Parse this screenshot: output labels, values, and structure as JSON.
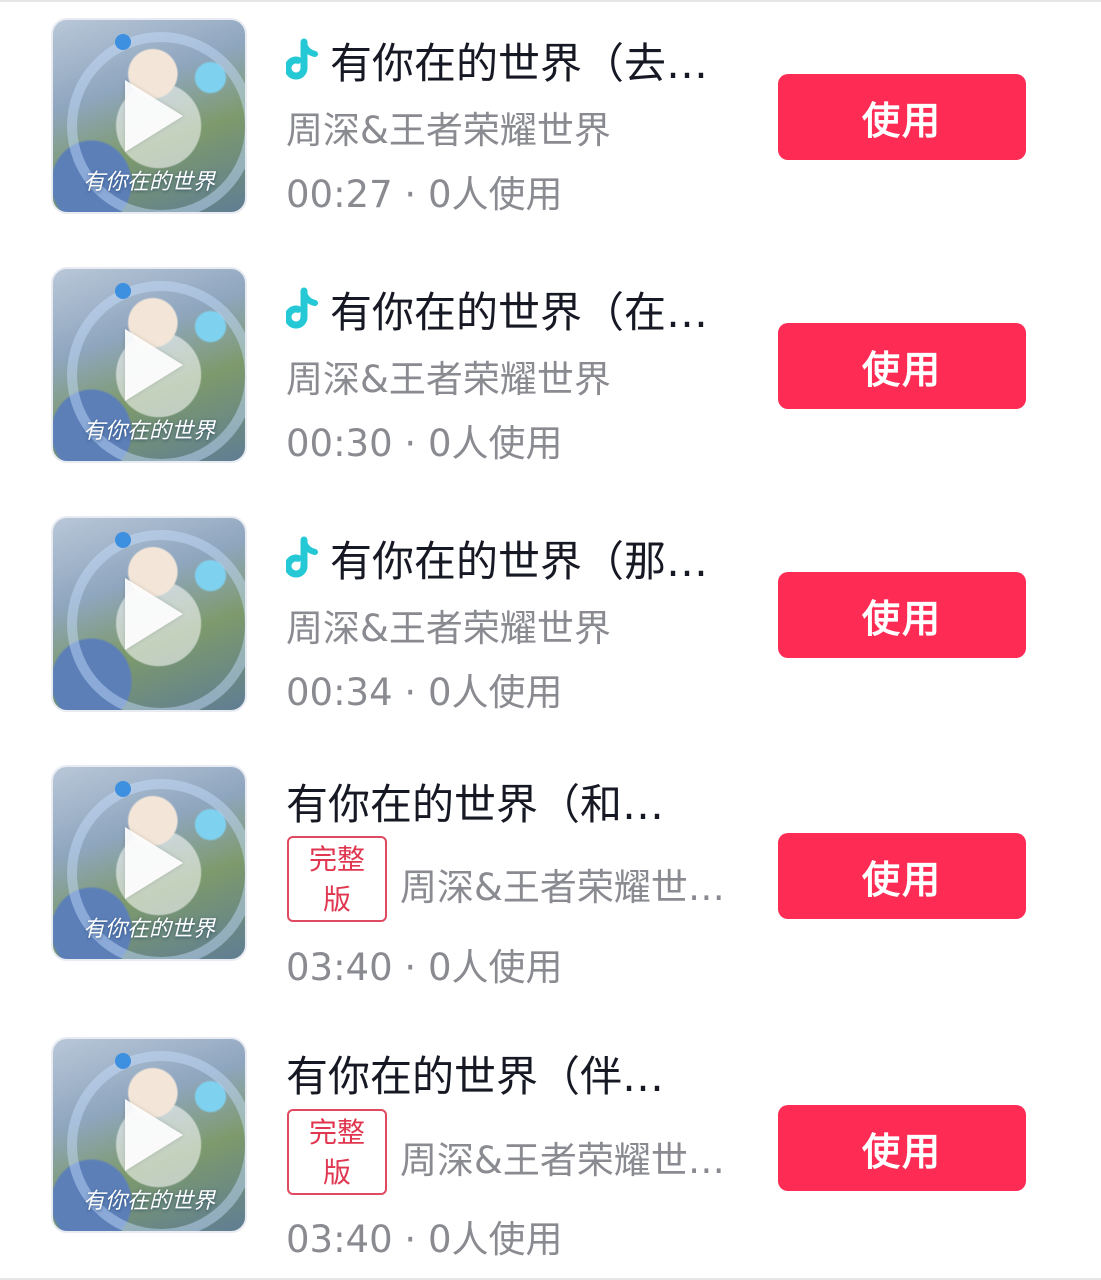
{
  "songs": [
    {
      "title": "有你在的世界（去…",
      "artist": "周深&王者荣耀世界",
      "duration": "00:27",
      "usage": "0人使用",
      "has_douyin_icon": true,
      "full_version": false,
      "cover_title": "有你在的世界",
      "button": "使用"
    },
    {
      "title": "有你在的世界（在…",
      "artist": "周深&王者荣耀世界",
      "duration": "00:30",
      "usage": "0人使用",
      "has_douyin_icon": true,
      "full_version": false,
      "cover_title": "有你在的世界",
      "button": "使用"
    },
    {
      "title": "有你在的世界（那…",
      "artist": "周深&王者荣耀世界",
      "duration": "00:34",
      "usage": "0人使用",
      "has_douyin_icon": true,
      "full_version": false,
      "cover_title": "",
      "button": "使用"
    },
    {
      "title": "有你在的世界（和…",
      "artist": "周深&王者荣耀世…",
      "duration": "03:40",
      "usage": "0人使用",
      "has_douyin_icon": false,
      "full_version": true,
      "badge_line1": "完整",
      "badge_line2": "版",
      "cover_title": "有你在的世界",
      "button": "使用"
    },
    {
      "title": "有你在的世界（伴…",
      "artist": "周深&王者荣耀世…",
      "duration": "03:40",
      "usage": "0人使用",
      "has_douyin_icon": false,
      "full_version": true,
      "badge_line1": "完整",
      "badge_line2": "版",
      "cover_title": "有你在的世界",
      "button": "使用"
    }
  ],
  "meta_separator": " · ",
  "colors": {
    "button": "#fe2c55",
    "badge": "#e0364f",
    "title": "#161823",
    "secondary": "#8a8b91"
  }
}
